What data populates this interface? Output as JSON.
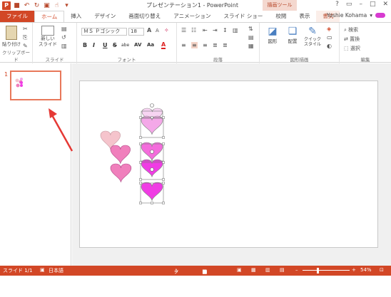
{
  "window": {
    "title": "プレゼンテーション1 - PowerPoint",
    "context_tools": "描画ツール",
    "help": "?"
  },
  "tabs": [
    "ファイル",
    "ホーム",
    "挿入",
    "デザイン",
    "画面切り替え",
    "アニメーション",
    "スライド ショー",
    "校閲",
    "表示",
    "書式"
  ],
  "user": {
    "name": "Yoshie Kohama"
  },
  "ribbon": {
    "clipboard": {
      "label": "クリップボード",
      "paste": "貼り付け"
    },
    "slides": {
      "label": "スライド",
      "new_slide": "新しい\nスライド"
    },
    "font": {
      "label": "フォント",
      "name": "ＭＳ Ｐゴシック",
      "size": "18",
      "bold": "B",
      "italic": "I",
      "underline": "U",
      "strike": "S",
      "shadow": "abe",
      "spacing": "AV",
      "case": "Aa"
    },
    "paragraph": {
      "label": "段落"
    },
    "drawing": {
      "label": "図形描画",
      "shapes": "図形",
      "arrange": "配置",
      "quick_styles": "クイック\nスタイル"
    },
    "editing": {
      "label": "編集",
      "find": "検索",
      "replace": "置換",
      "select": "選択"
    }
  },
  "thumb": {
    "number": "1"
  },
  "status": {
    "slide": "スライド 1/1",
    "lang": "日本語",
    "notes": "ノート",
    "comments": "コメント",
    "zoom": "54%"
  },
  "colors": {
    "accent": "#d24726",
    "heart_pale": "#f5c4cc",
    "heart_pink": "#f07fbc",
    "heart_light": "#f4a8e8",
    "heart_magenta": "#f03ce4"
  }
}
